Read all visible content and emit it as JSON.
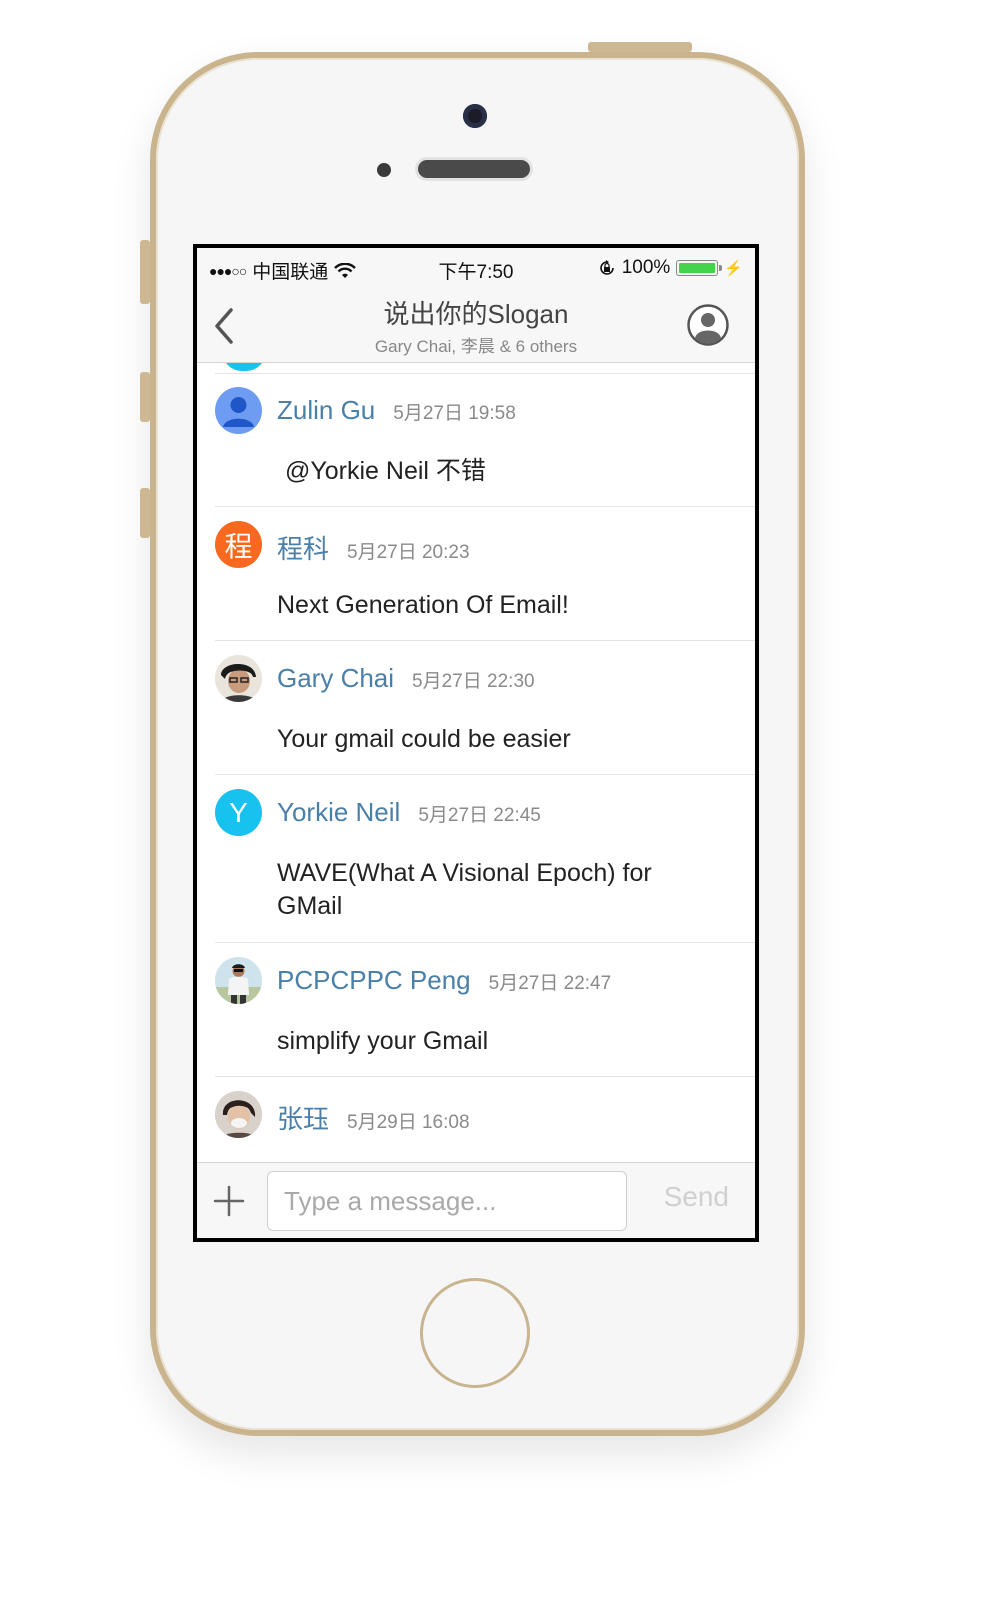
{
  "status_bar": {
    "signal": "●●●○○",
    "carrier": "中国联通",
    "time": "下午7:50",
    "battery_percent": "100%",
    "battery_level": 1.0,
    "icons": [
      "wifi-icon",
      "rotation-lock-icon",
      "battery-icon",
      "charging-bolt-icon"
    ]
  },
  "nav": {
    "title": "说出你的Slogan",
    "subtitle": "Gary Chai, 李晨 & 6 others",
    "icons": [
      "back-chevron-icon",
      "profile-icon"
    ]
  },
  "messages": [
    {
      "name": "Zulin Gu",
      "time": "5月27日 19:58",
      "text": "@Yorkie Neil  不错",
      "avatar": "person-silhouette",
      "avatar_color": "#6d9cf2"
    },
    {
      "name": "程科",
      "time": "5月27日 20:23",
      "text": "Next Generation Of Email!",
      "avatar_letter": "程",
      "avatar_color": "#f8681e"
    },
    {
      "name": "Gary Chai",
      "time": "5月27日 22:30",
      "text": "Your gmail could be easier",
      "avatar": "photo"
    },
    {
      "name": "Yorkie Neil",
      "time": "5月27日 22:45",
      "text": "WAVE(What A Visional Epoch) for GMail",
      "avatar_letter": "Y",
      "avatar_color": "#17c2ef"
    },
    {
      "name": "PCPCPPC Peng",
      "time": "5月27日 22:47",
      "text": "simplify your Gmail",
      "avatar": "photo"
    },
    {
      "name": "张珏",
      "time": "5月29日 16:08",
      "text": "",
      "avatar": "photo"
    }
  ],
  "input_bar": {
    "placeholder": "Type a message...",
    "value": "",
    "send_label": "Send",
    "icons": [
      "plus-icon"
    ]
  },
  "colors": {
    "name_blue": "#4a7fa8",
    "time_gray": "#8a8a8a",
    "phone_gold": "#c9b48d",
    "battery_green": "#44d44c"
  }
}
